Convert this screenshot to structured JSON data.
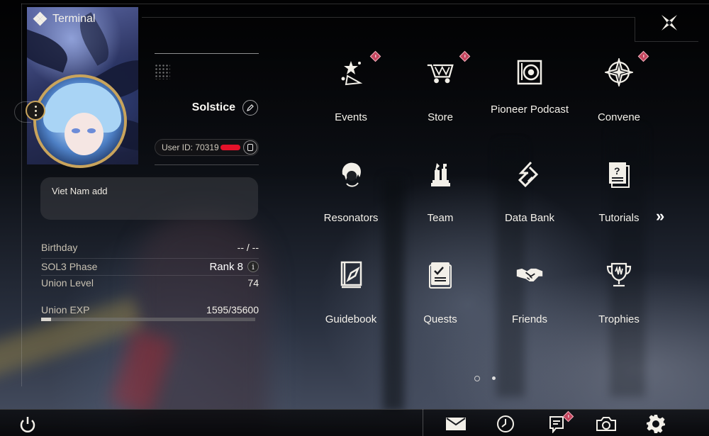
{
  "header": {
    "title": "Terminal"
  },
  "profile": {
    "username": "Solstice",
    "user_id_label": "User ID: 70319",
    "signature": "Viet Nam add",
    "stats": {
      "birthday_label": "Birthday",
      "birthday_value": "-- / --",
      "phase_label": "SOL3 Phase",
      "phase_value": "Rank 8",
      "union_level_label": "Union Level",
      "union_level_value": "74",
      "union_exp_label": "Union EXP",
      "union_exp_value": "1595/35600",
      "union_exp_fraction": 0.045
    }
  },
  "menu": {
    "items": [
      {
        "label": "Events",
        "icon": "events-icon",
        "badge": true
      },
      {
        "label": "Store",
        "icon": "cart-icon",
        "badge": true
      },
      {
        "label": "Pioneer Podcast",
        "icon": "podcast-icon",
        "badge": false
      },
      {
        "label": "Convene",
        "icon": "convene-icon",
        "badge": true
      },
      {
        "label": "Resonators",
        "icon": "resonator-icon",
        "badge": false
      },
      {
        "label": "Team",
        "icon": "team-icon",
        "badge": false
      },
      {
        "label": "Data Bank",
        "icon": "data-bank-icon",
        "badge": false
      },
      {
        "label": "Tutorials",
        "icon": "tutorial-icon",
        "badge": false
      },
      {
        "label": "Guidebook",
        "icon": "guidebook-icon",
        "badge": false
      },
      {
        "label": "Quests",
        "icon": "quests-icon",
        "badge": false
      },
      {
        "label": "Friends",
        "icon": "handshake-icon",
        "badge": false
      },
      {
        "label": "Trophies",
        "icon": "trophy-icon",
        "badge": false
      }
    ],
    "current_page": 1,
    "total_pages": 2
  },
  "bottom_bar": {
    "icons": [
      "power-icon",
      "mail-icon",
      "clock-icon",
      "notice-icon",
      "camera-icon",
      "settings-icon"
    ],
    "notice_badge": true
  },
  "colors": {
    "accent_gold": "#c9a45c",
    "badge_red": "#c5455e",
    "redaction": "#e4122a"
  }
}
